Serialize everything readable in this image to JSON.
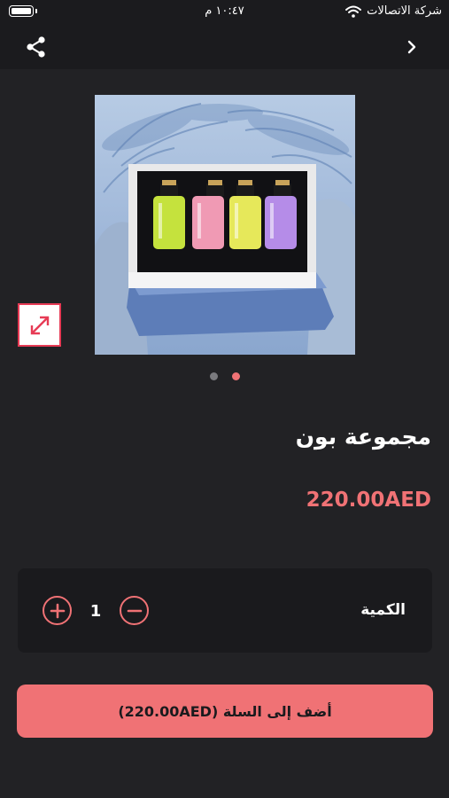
{
  "status_bar": {
    "time": "١٠:٤٧ م",
    "carrier": "شركة الاتصالات"
  },
  "nav": {
    "share_icon": "share-icon",
    "back_icon": "chevron-right-icon"
  },
  "gallery": {
    "image_alt": "perfume-gift-set-photo",
    "expand_icon": "expand-arrows-icon",
    "page_count": 2,
    "active_page": 2
  },
  "product": {
    "title": "مجموعة بون",
    "price": "220.00AED"
  },
  "quantity": {
    "label": "الكمية",
    "value": "1",
    "plus_icon": "plus-circle-icon",
    "minus_icon": "minus-circle-icon"
  },
  "cart_button": {
    "label": "أضف إلى السلة (220.00AED)"
  },
  "colors": {
    "background": "#222225",
    "bar": "#1b1b1e",
    "accent": "#f07275",
    "price": "#f07275",
    "dot_inactive": "#7a7a7e",
    "dot_active": "#f07275",
    "card": "#1a1a1d",
    "expand_border": "#e73b55"
  }
}
